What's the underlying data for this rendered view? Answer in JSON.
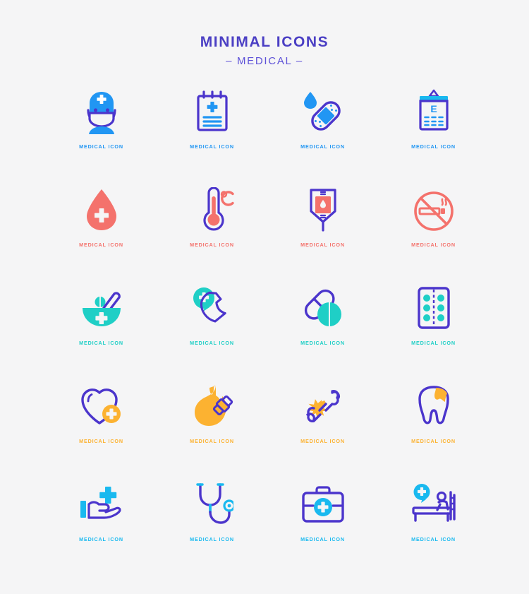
{
  "header": {
    "title": "MINIMAL ICONS",
    "subtitle": "– MEDICAL –",
    "title_color": "#4b3fc4",
    "subtitle_color": "#5e52d8"
  },
  "background_color": "#f5f5f6",
  "palette": {
    "blue": "#2196f3",
    "purple": "#4b35cc",
    "coral": "#f4726c",
    "turquoise": "#1fcfc6",
    "orange": "#fcb231",
    "cyan": "#19b9ef",
    "white": "#f5f5f6"
  },
  "caption_text": "MEDICAL ICON",
  "grid": {
    "columns": 4,
    "rows": 5
  },
  "rows": [
    {
      "accent": "#2196f3",
      "icons": [
        {
          "name": "doctor-icon",
          "label": "MEDICAL ICON"
        },
        {
          "name": "medical-clipboard-icon",
          "label": "MEDICAL ICON"
        },
        {
          "name": "bandage-drop-icon",
          "label": "MEDICAL ICON"
        },
        {
          "name": "eye-chart-icon",
          "label": "MEDICAL ICON"
        }
      ]
    },
    {
      "accent": "#f4726c",
      "icons": [
        {
          "name": "blood-drop-cross-icon",
          "label": "MEDICAL ICON"
        },
        {
          "name": "thermometer-celsius-icon",
          "label": "MEDICAL ICON"
        },
        {
          "name": "iv-blood-bag-icon",
          "label": "MEDICAL ICON"
        },
        {
          "name": "no-smoking-icon",
          "label": "MEDICAL ICON"
        }
      ]
    },
    {
      "accent": "#1fcfc6",
      "icons": [
        {
          "name": "mortar-pestle-icon",
          "label": "MEDICAL ICON"
        },
        {
          "name": "emergency-call-icon",
          "label": "MEDICAL ICON"
        },
        {
          "name": "capsule-pill-icon",
          "label": "MEDICAL ICON"
        },
        {
          "name": "pill-blister-pack-icon",
          "label": "MEDICAL ICON"
        }
      ]
    },
    {
      "accent": "#fcb231",
      "icons": [
        {
          "name": "heart-plus-icon",
          "label": "MEDICAL ICON"
        },
        {
          "name": "stomach-bandage-icon",
          "label": "MEDICAL ICON"
        },
        {
          "name": "broken-bone-icon",
          "label": "MEDICAL ICON"
        },
        {
          "name": "tooth-cavity-icon",
          "label": "MEDICAL ICON"
        }
      ]
    },
    {
      "accent": "#19b9ef",
      "icons": [
        {
          "name": "hand-cross-care-icon",
          "label": "MEDICAL ICON"
        },
        {
          "name": "stethoscope-icon",
          "label": "MEDICAL ICON"
        },
        {
          "name": "first-aid-kit-icon",
          "label": "MEDICAL ICON"
        },
        {
          "name": "hospital-bed-icon",
          "label": "MEDICAL ICON"
        }
      ]
    }
  ],
  "labels": {
    "eye_chart_letter": "E",
    "thermometer_unit": "°C"
  }
}
